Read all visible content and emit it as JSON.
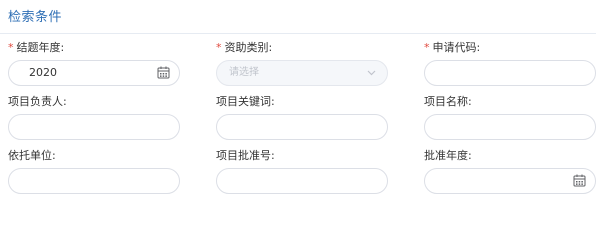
{
  "panel": {
    "title": "检索条件"
  },
  "fields": {
    "year": {
      "label": "结题年度:",
      "required_mark": "*",
      "value": "2020",
      "icon": "calendar-icon"
    },
    "funding_type": {
      "label": "资助类别:",
      "required_mark": "*",
      "placeholder": "请选择",
      "icon": "chevron-down-icon"
    },
    "application_code": {
      "label": "申请代码:",
      "required_mark": "*",
      "value": ""
    },
    "project_leader": {
      "label": "项目负责人:",
      "value": ""
    },
    "project_keywords": {
      "label": "项目关键词:",
      "value": ""
    },
    "project_name": {
      "label": "项目名称:",
      "value": ""
    },
    "host_institution": {
      "label": "依托单位:",
      "value": ""
    },
    "approval_number": {
      "label": "项目批准号:",
      "value": ""
    },
    "approval_year": {
      "label": "批准年度:",
      "value": "",
      "icon": "calendar-icon"
    }
  },
  "colors": {
    "title": "#2f6fb5",
    "required": "#e0493e",
    "border": "#dcdfe6",
    "placeholder": "#c0c4cc"
  }
}
